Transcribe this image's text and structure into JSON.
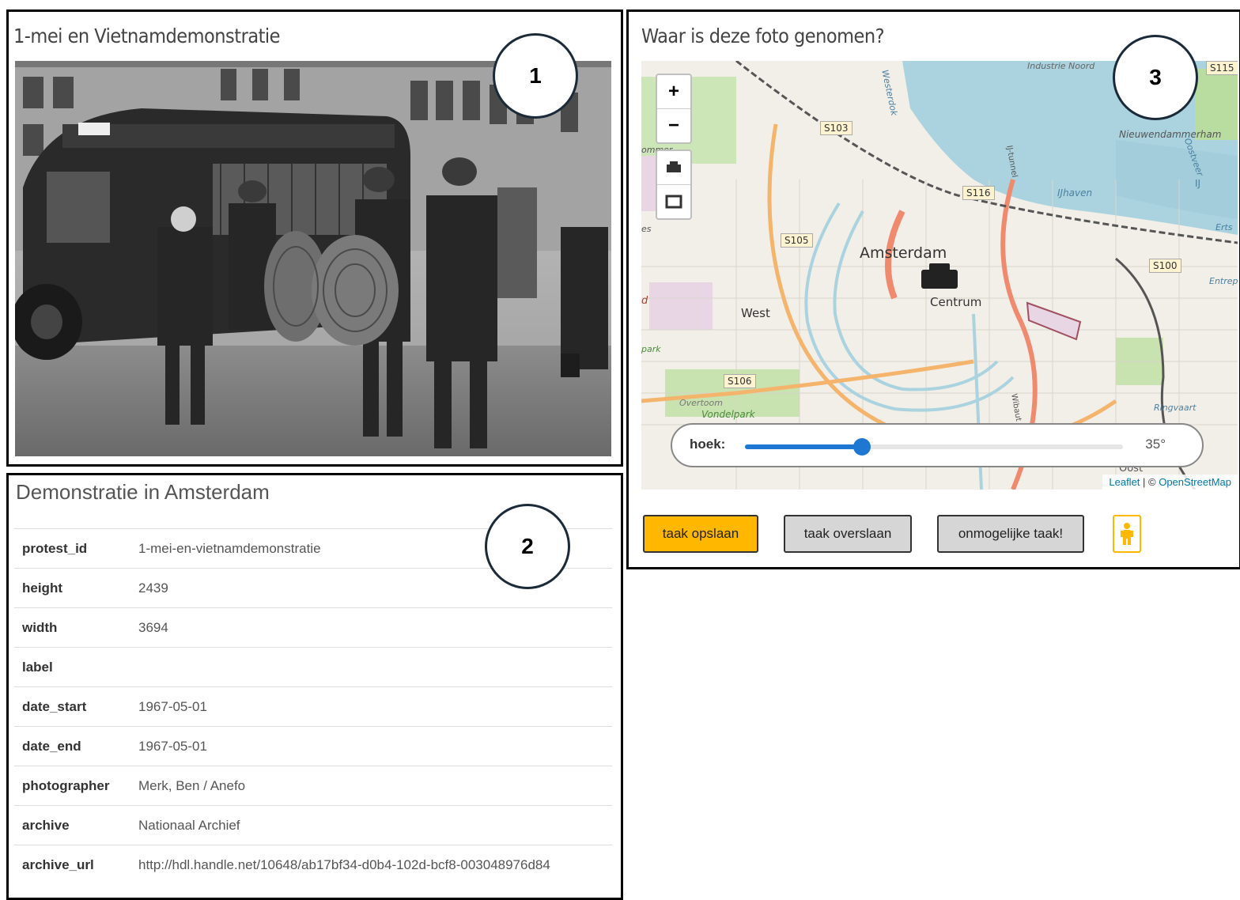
{
  "photo_panel": {
    "title": "1-mei en Vietnamdemonstratie",
    "badge": "1"
  },
  "meta_panel": {
    "title": "Demonstratie in Amsterdam",
    "badge": "2",
    "rows": [
      {
        "key": "protest_id",
        "value": "1-mei-en-vietnamdemonstratie"
      },
      {
        "key": "height",
        "value": "2439"
      },
      {
        "key": "width",
        "value": "3694"
      },
      {
        "key": "label",
        "value": ""
      },
      {
        "key": "date_start",
        "value": "1967-05-01"
      },
      {
        "key": "date_end",
        "value": "1967-05-01"
      },
      {
        "key": "photographer",
        "value": "Merk, Ben / Anefo"
      },
      {
        "key": "archive",
        "value": "Nationaal Archief"
      },
      {
        "key": "archive_url",
        "value": "http://hdl.handle.net/10648/ab17bf34-d0b4-102d-bcf8-003048976d84"
      }
    ]
  },
  "map_panel": {
    "title": "Waar is deze foto genomen?",
    "badge": "3",
    "zoom_in": "+",
    "zoom_out": "−",
    "labels": {
      "city": "Amsterdam",
      "centrum": "Centrum",
      "west": "West",
      "nieuwendammerham": "Nieuwendammerham",
      "vondelpark": "Vondelpark",
      "overtoom": "Overtoom",
      "s103": "S103",
      "s105": "S105",
      "s106": "S106",
      "s116": "S116",
      "s100": "S100",
      "s115": "S115",
      "ij": "IJ",
      "ijhaven": "IJhaven",
      "industrie": "Industrie Noord",
      "ringvaart": "Ringvaart",
      "entrepot": "Entrep",
      "park": "park",
      "ommer": "ommer",
      "es": "es",
      "d": "d",
      "erts": "Erts",
      "oost": "Oost",
      "westerdok": "Westerdok",
      "oostveer": "Oostveer",
      "wibaut": "Wibaut",
      "ij_tunnel": "IJ-tunnel"
    },
    "slider": {
      "label": "hoek:",
      "value_text": "35°",
      "fraction": 0.31
    },
    "attribution": {
      "leaflet": "Leaflet",
      "sep": " | © ",
      "osm": "OpenStreetMap"
    }
  },
  "actions": {
    "save": "taak opslaan",
    "skip": "taak overslaan",
    "impossible": "onmogelijke taak!"
  },
  "colors": {
    "save_button": "#ffb700",
    "slider_accent": "#1e78d3",
    "badge_border": "#1b2a38"
  }
}
